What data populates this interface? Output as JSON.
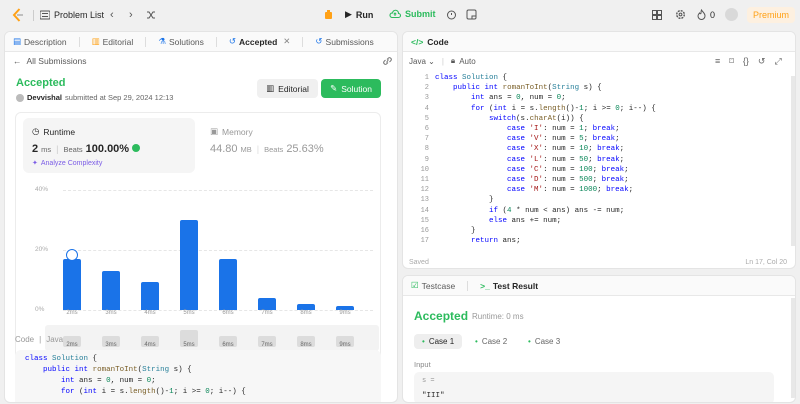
{
  "topbar": {
    "problem_list": "Problem List",
    "run": "Run",
    "submit": "Submit",
    "streak": "0",
    "premium": "Premium"
  },
  "colors": {
    "accent_green": "#2cbb5d",
    "chart_bar": "#1a73e8",
    "premium": "#ffa116"
  },
  "left_tabs": [
    {
      "label": "Description"
    },
    {
      "label": "Editorial"
    },
    {
      "label": "Solutions"
    },
    {
      "label": "Accepted"
    },
    {
      "label": "Submissions"
    }
  ],
  "submission": {
    "all_submissions": "All Submissions",
    "status": "Accepted",
    "user": "Devvishal",
    "submitted_text": "submitted at Sep 29, 2024 12:13",
    "editorial_btn": "Editorial",
    "solution_btn": "Solution",
    "runtime_label": "Runtime",
    "runtime_value": "2",
    "runtime_unit": "ms",
    "beats_label": "Beats",
    "runtime_beats": "100.00%",
    "analyze": "Analyze Complexity",
    "memory_label": "Memory",
    "memory_value": "44.80",
    "memory_unit": "MB",
    "memory_beats": "25.63%"
  },
  "chart_data": {
    "type": "bar",
    "categories": [
      "2ms",
      "3ms",
      "4ms",
      "5ms",
      "6ms",
      "7ms",
      "8ms",
      "9ms"
    ],
    "values": [
      17,
      13,
      9.5,
      30,
      17,
      4,
      2,
      1.5
    ],
    "yticks": [
      "40%",
      "20%",
      "0%"
    ],
    "ylim": [
      0,
      40
    ],
    "mini_labels": [
      "2ms",
      "3ms",
      "4ms",
      "5ms",
      "6ms",
      "7ms",
      "8ms",
      "9ms"
    ]
  },
  "bottom_code": {
    "label": "Code",
    "lang": "Java",
    "lines": [
      "class Solution {",
      "    public int romanToInt(String s) {",
      "        int ans = 0, num = 0;",
      "        for (int i = s.length()-1; i >= 0; i--) {"
    ]
  },
  "editor": {
    "title": "Code",
    "lang": "Java",
    "auto": "Auto",
    "saved": "Saved",
    "cursor": "Ln 17, Col 20",
    "lines": [
      "class Solution {",
      "    public int romanToInt(String s) {",
      "        int ans = 0, num = 0;",
      "        for (int i = s.length()-1; i >= 0; i--) {",
      "            switch(s.charAt(i)) {",
      "                case 'I': num = 1; break;",
      "                case 'V': num = 5; break;",
      "                case 'X': num = 10; break;",
      "                case 'L': num = 50; break;",
      "                case 'C': num = 100; break;",
      "                case 'D': num = 500; break;",
      "                case 'M': num = 1000; break;",
      "            }",
      "            if (4 * num < ans) ans -= num;",
      "            else ans += num;",
      "        }",
      "        return ans;"
    ]
  },
  "result": {
    "testcase_tab": "Testcase",
    "result_tab": "Test Result",
    "status": "Accepted",
    "runtime": "Runtime: 0 ms",
    "cases": [
      "Case 1",
      "Case 2",
      "Case 3"
    ],
    "input_label": "Input",
    "var": "s =",
    "value": "\"III\""
  }
}
